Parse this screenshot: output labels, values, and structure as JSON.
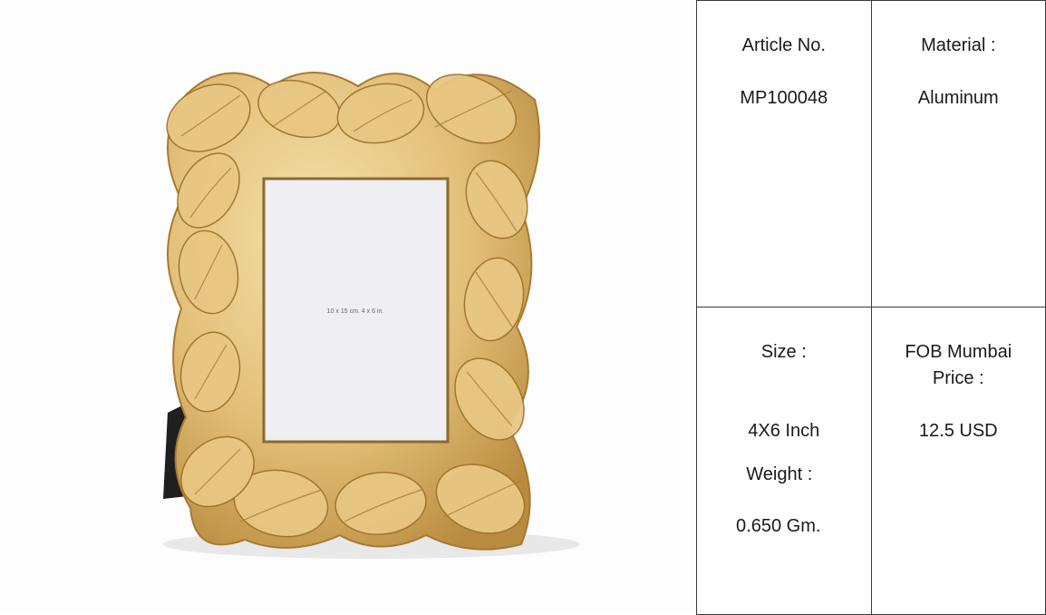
{
  "product_image": {
    "description_label": "gold-leaf-photo-frame",
    "insert_text_line1": "10 x 15 cm.    4 x 6 in."
  },
  "specs": {
    "article_label": "Article No.",
    "article_value": "MP100048",
    "material_label": "Material :",
    "material_value": "Aluminum",
    "size_label": "Size :",
    "size_value": "4X6 Inch",
    "weight_label": "Weight :",
    "weight_value": "0.650 Gm.",
    "price_label_line1": "FOB Mumbai",
    "price_label_line2": "Price :",
    "price_value": "12.5 USD"
  },
  "colors": {
    "gold_light": "#ecd08e",
    "gold_mid": "#d9b36a",
    "gold_dark": "#b88b3e",
    "border": "#3a3a3a"
  }
}
